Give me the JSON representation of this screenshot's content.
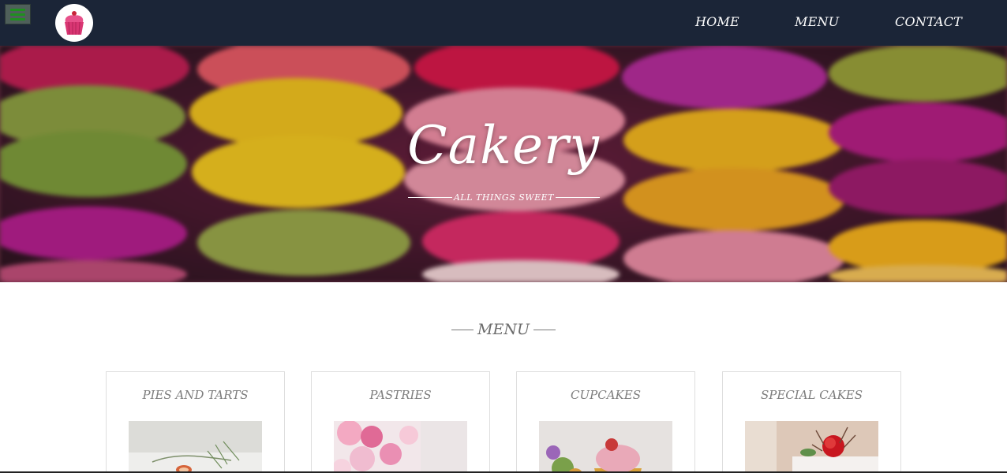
{
  "header": {
    "menu_toggle_icon": "hamburger-icon",
    "logo_icon": "cupcake-icon",
    "nav": [
      {
        "label": "HOME"
      },
      {
        "label": "MENU"
      },
      {
        "label": "CONTACT"
      }
    ],
    "colors": {
      "bar": "#1b2537",
      "toggle_lines": "#1f8f1f"
    }
  },
  "hero": {
    "title": "Cakery",
    "subtitle": "ALL THINGS SWEET"
  },
  "menu": {
    "heading": "MENU",
    "cards": [
      {
        "title": "PIES AND TARTS"
      },
      {
        "title": "PASTRIES"
      },
      {
        "title": "CUPCAKES"
      },
      {
        "title": "SPECIAL CAKES"
      }
    ]
  }
}
